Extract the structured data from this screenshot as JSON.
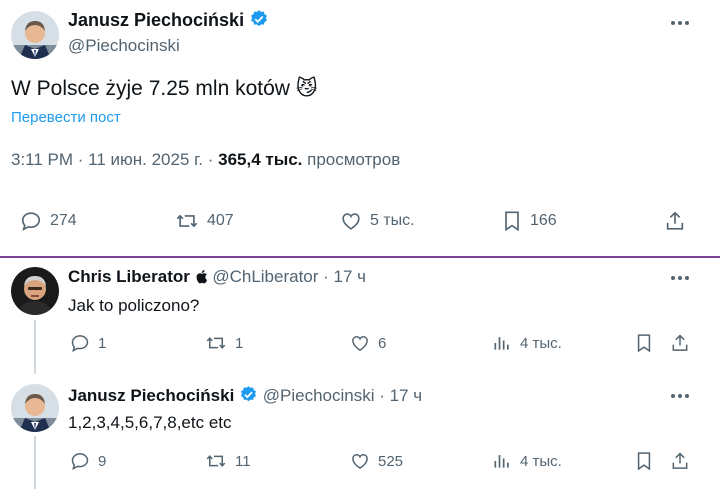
{
  "main_tweet": {
    "author_name": "Janusz Piechociński",
    "handle": "@Piechocinski",
    "text": "W Polsce żyje 7.25 mln kotów",
    "emoji": "😼",
    "translate_link": "Перевести пост",
    "time": "3:11 PM · 11 июн. 2025 г. · ",
    "views_count": "365,4 тыс.",
    "views_label": " просмотров",
    "stats": {
      "replies": "274",
      "reposts": "407",
      "likes": "5 тыс.",
      "bookmarks": "166"
    }
  },
  "reply1": {
    "author_name": "Chris Liberator",
    "badge": "",
    "handle": "@ChLiberator",
    "time": "· 17 ч",
    "text": "Jak to policzono?",
    "stats": {
      "replies": "1",
      "reposts": "1",
      "likes": "6",
      "views": "4 тыс."
    }
  },
  "reply2": {
    "author_name": "Janusz Piechociński",
    "handle": "@Piechocinski",
    "time": "· 17 ч",
    "text": "1,2,3,4,5,6,7,8,etc etc",
    "stats": {
      "replies": "9",
      "reposts": "11",
      "likes": "525",
      "views": "4 тыс."
    }
  },
  "colors": {
    "accent": "#1d9bf0",
    "muted": "#536471",
    "divider": "#7b3f8f",
    "verified": "#1d9bf0"
  }
}
